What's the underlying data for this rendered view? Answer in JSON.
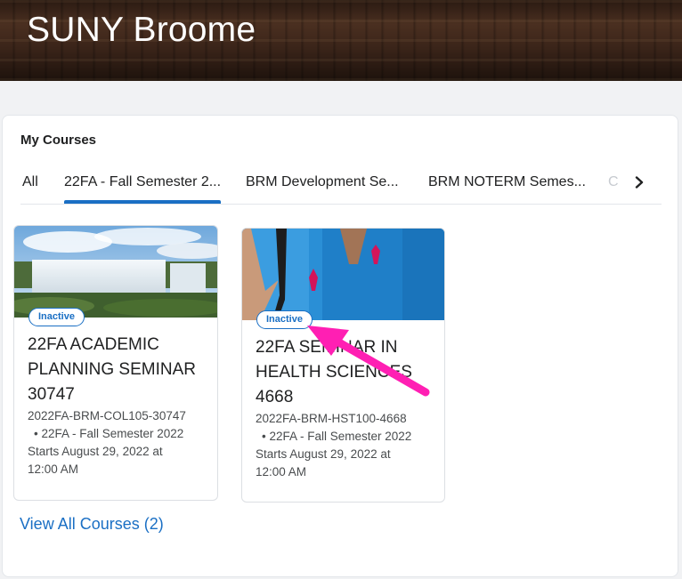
{
  "header": {
    "title": "SUNY Broome"
  },
  "widget": {
    "title": "My Courses",
    "tabs": [
      {
        "label": "All"
      },
      {
        "label": "22FA - Fall Semester 2..."
      },
      {
        "label": "BRM Development Se..."
      },
      {
        "label": "BRM NOTERM Semes..."
      },
      {
        "label": "C"
      }
    ],
    "active_tab": "22FA - Fall Semester 2...",
    "courses": [
      {
        "badge": "Inactive",
        "title_lines": [
          "22FA ACADEMIC",
          "PLANNING SEMINAR",
          "30747"
        ],
        "code": "2022FA-BRM-COL105-30747",
        "semester": "•  22FA - Fall Semester 2022",
        "start_lines": [
          "Starts August 29, 2022 at",
          "12:00 AM"
        ]
      },
      {
        "badge": "Inactive",
        "title_lines": [
          "22FA SEMINAR IN",
          "HEALTH SCIENCES",
          "4668"
        ],
        "code": "2022FA-BRM-HST100-4668",
        "semester": "•  22FA - Fall Semester 2022",
        "start_lines": [
          "Starts August 29, 2022 at",
          "12:00 AM"
        ]
      }
    ],
    "view_all": "View All Courses (2)"
  },
  "colors": {
    "accent": "#1a6fc4",
    "annotation_arrow": "#ff1fb3"
  },
  "icons": {
    "tab_next": "chevron-right-icon"
  }
}
